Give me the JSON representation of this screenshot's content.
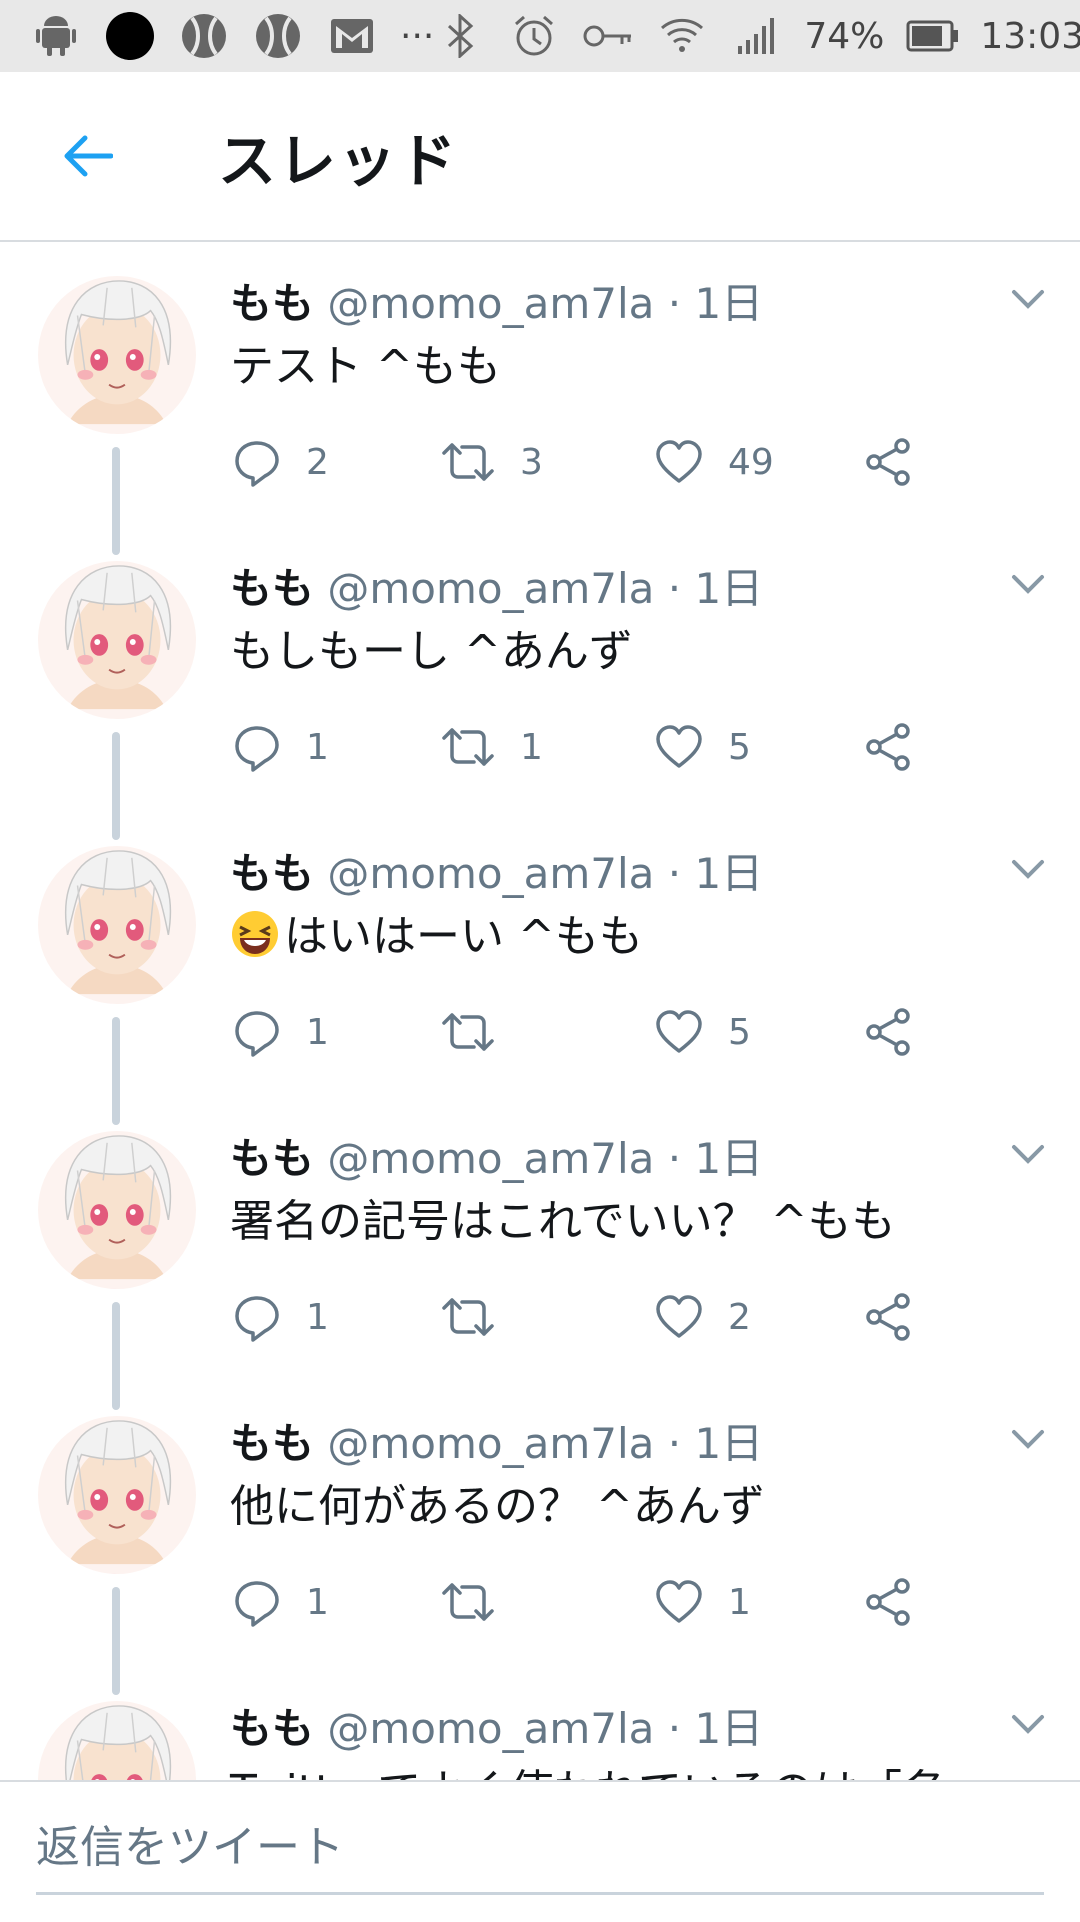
{
  "status_bar": {
    "battery": "74%",
    "time": "13:03",
    "dots": "···",
    "icons": [
      "android-icon",
      "record-icon",
      "tennis-ball-icon",
      "tennis-ball-icon",
      "mail-icon",
      "more-icon",
      "bluetooth-icon",
      "alarm-icon",
      "vpn-key-icon",
      "wifi-icon",
      "signal-icon",
      "battery-icon"
    ]
  },
  "header": {
    "title": "スレッド"
  },
  "tweets": [
    {
      "name": "もも",
      "handle": "@momo_am7la",
      "sep": "·",
      "time": "1日",
      "text": "テスト ^もも",
      "replies": "2",
      "retweets": "3",
      "likes": "49"
    },
    {
      "name": "もも",
      "handle": "@momo_am7la",
      "sep": "·",
      "time": "1日",
      "text": "もしもーし ^あんず",
      "replies": "1",
      "retweets": "1",
      "likes": "5"
    },
    {
      "name": "もも",
      "handle": "@momo_am7la",
      "sep": "·",
      "time": "1日",
      "text": "はいはーい ^もも",
      "replies": "1",
      "retweets": "",
      "likes": "5"
    },
    {
      "name": "もも",
      "handle": "@momo_am7la",
      "sep": "·",
      "time": "1日",
      "text": "署名の記号はこれでいい？ ^もも",
      "replies": "1",
      "retweets": "",
      "likes": "2"
    },
    {
      "name": "もも",
      "handle": "@momo_am7la",
      "sep": "·",
      "time": "1日",
      "text": "他に何があるの？ ^あんず",
      "replies": "1",
      "retweets": "",
      "likes": "1"
    },
    {
      "name": "もも",
      "handle": "@momo_am7la",
      "sep": "·",
      "time": "1日",
      "text": "Twitterでよく使われているのは「名"
    }
  ],
  "reply_bar": {
    "placeholder": "返信をツイート"
  },
  "colors": {
    "accent": "#1da1f2",
    "secondary_text": "#657786",
    "thread_line": "#c9d3dc"
  }
}
